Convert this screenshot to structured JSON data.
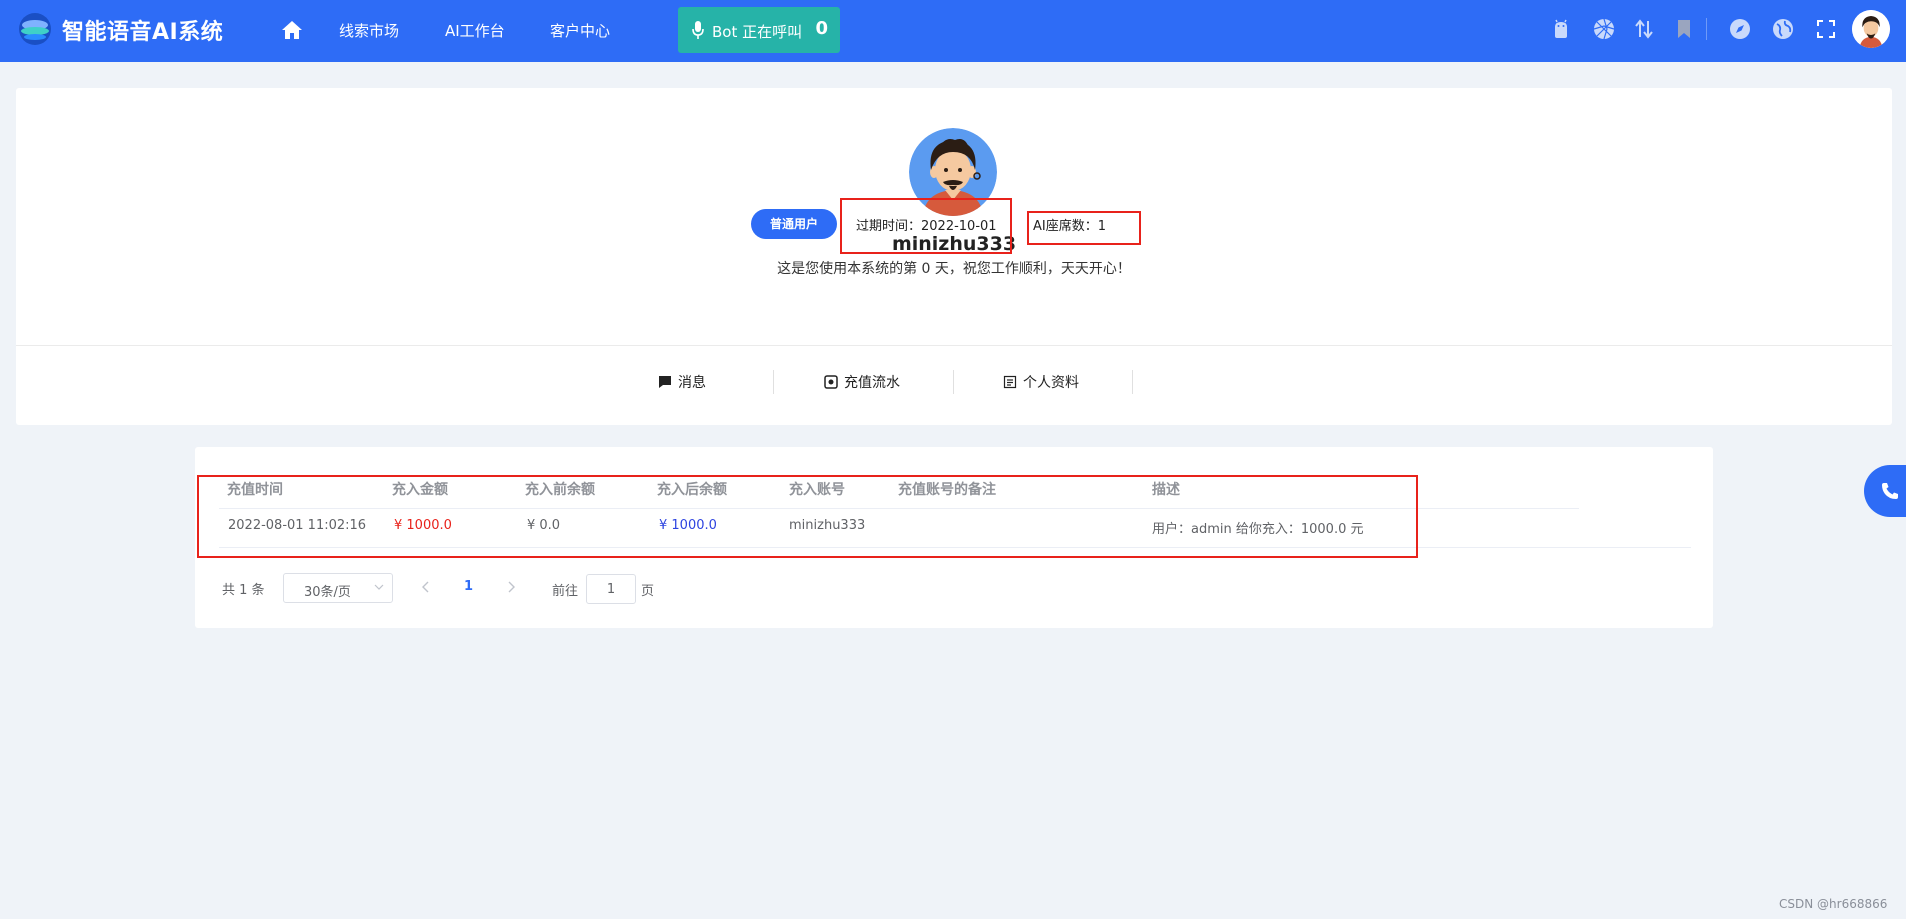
{
  "header": {
    "brand": "智能语音AI系统",
    "nav": [
      "线索市场",
      "AI工作台",
      "客户中心"
    ],
    "bot_label": "Bot 正在呼叫",
    "bot_count": "0",
    "icons": [
      "android-icon",
      "aperture-icon",
      "transfer-arrows-icon",
      "bookmark-icon",
      "compass-icon",
      "globe-icon",
      "fullscreen-icon"
    ]
  },
  "profile": {
    "username": "minizhu333",
    "greeting": "这是您使用本系统的第 0 天，祝您工作顺利，天天开心！",
    "role": "普通用户",
    "expire": "过期时间：2022-10-01",
    "seats": "AI座席数：1",
    "tabs": [
      "消息",
      "充值流水",
      "个人资料"
    ]
  },
  "table": {
    "headers": [
      "充值时间",
      "充入金额",
      "充入前余额",
      "充入后余额",
      "充入账号",
      "充值账号的备注",
      "描述"
    ],
    "rows": [
      {
        "time": "2022-08-01 11:02:16",
        "amount": "¥ 1000.0",
        "before": "¥ 0.0",
        "after": "¥ 1000.0",
        "account": "minizhu333",
        "remark": "",
        "desc": "用户：admin 给你充入：1000.0 元"
      }
    ]
  },
  "pager": {
    "total": "共 1 条",
    "page_size": "30条/页",
    "current": "1",
    "goto_label": "前往",
    "goto_value": "1",
    "page_label": "页"
  },
  "watermark": "CSDN @hr668866",
  "colors": {
    "primary": "#2e6cf6",
    "bot_button": "#26b3a8",
    "highlight_frame": "#e8221b",
    "amount": "#e8221b",
    "after_balance": "#2e44e0"
  }
}
